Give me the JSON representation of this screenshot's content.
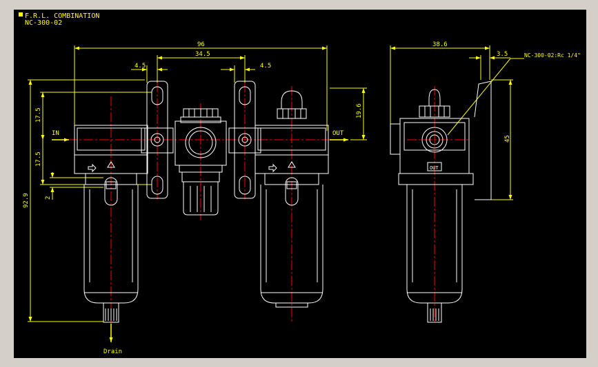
{
  "title": {
    "line1": "F.R.L. COMBINATION",
    "line2": "NC-300-02"
  },
  "dimensions": {
    "overall_width": "96",
    "center_distance": "34.5",
    "bracket_left": "4.5",
    "bracket_right": "4.5",
    "side_width": "38.6",
    "side_offset": "3.5",
    "port_to_top": "19.6",
    "side_height": "45",
    "upper_height": "17.5",
    "lower_height": "17.5",
    "small_gap": "2",
    "total_height": "92.9"
  },
  "labels": {
    "in": "IN",
    "out": "OUT",
    "drain": "Drain",
    "port_callout": "NC-300-02:Rc 1/4\"",
    "side_out_plate": "OUT"
  },
  "colors": {
    "background": "#000000",
    "outline": "#ffffff",
    "dimension": "#ffff00",
    "center_line": "#ff0000",
    "window_frame": "#d4d0c8"
  }
}
